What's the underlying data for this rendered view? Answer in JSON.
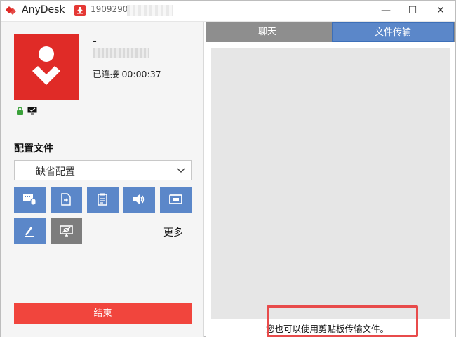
{
  "titlebar": {
    "app_name": "AnyDesk",
    "session_id_visible": "1909290",
    "minimize_glyph": "—",
    "maximize_glyph": "☐",
    "close_glyph": "✕"
  },
  "peer": {
    "name": "-",
    "status": "已连接 00:00:37"
  },
  "profile": {
    "title": "配置文件",
    "selected": "缺省配置"
  },
  "toolbar": {
    "tools": [
      {
        "name": "keyboard-mouse-icon"
      },
      {
        "name": "file-transfer-icon"
      },
      {
        "name": "clipboard-icon"
      },
      {
        "name": "audio-icon"
      },
      {
        "name": "screen-icon"
      },
      {
        "name": "whiteboard-pen-icon"
      },
      {
        "name": "privacy-screen-icon"
      }
    ],
    "more_label": "更多"
  },
  "actions": {
    "end_label": "结束"
  },
  "tabs": {
    "chat": "聊天",
    "file_transfer": "文件传输"
  },
  "file_pane": {
    "hint": "您也可以使用剪贴板传输文件。"
  },
  "colors": {
    "accent_blue": "#5b87c9",
    "brand_red": "#e02b27",
    "end_red": "#f1453d"
  }
}
